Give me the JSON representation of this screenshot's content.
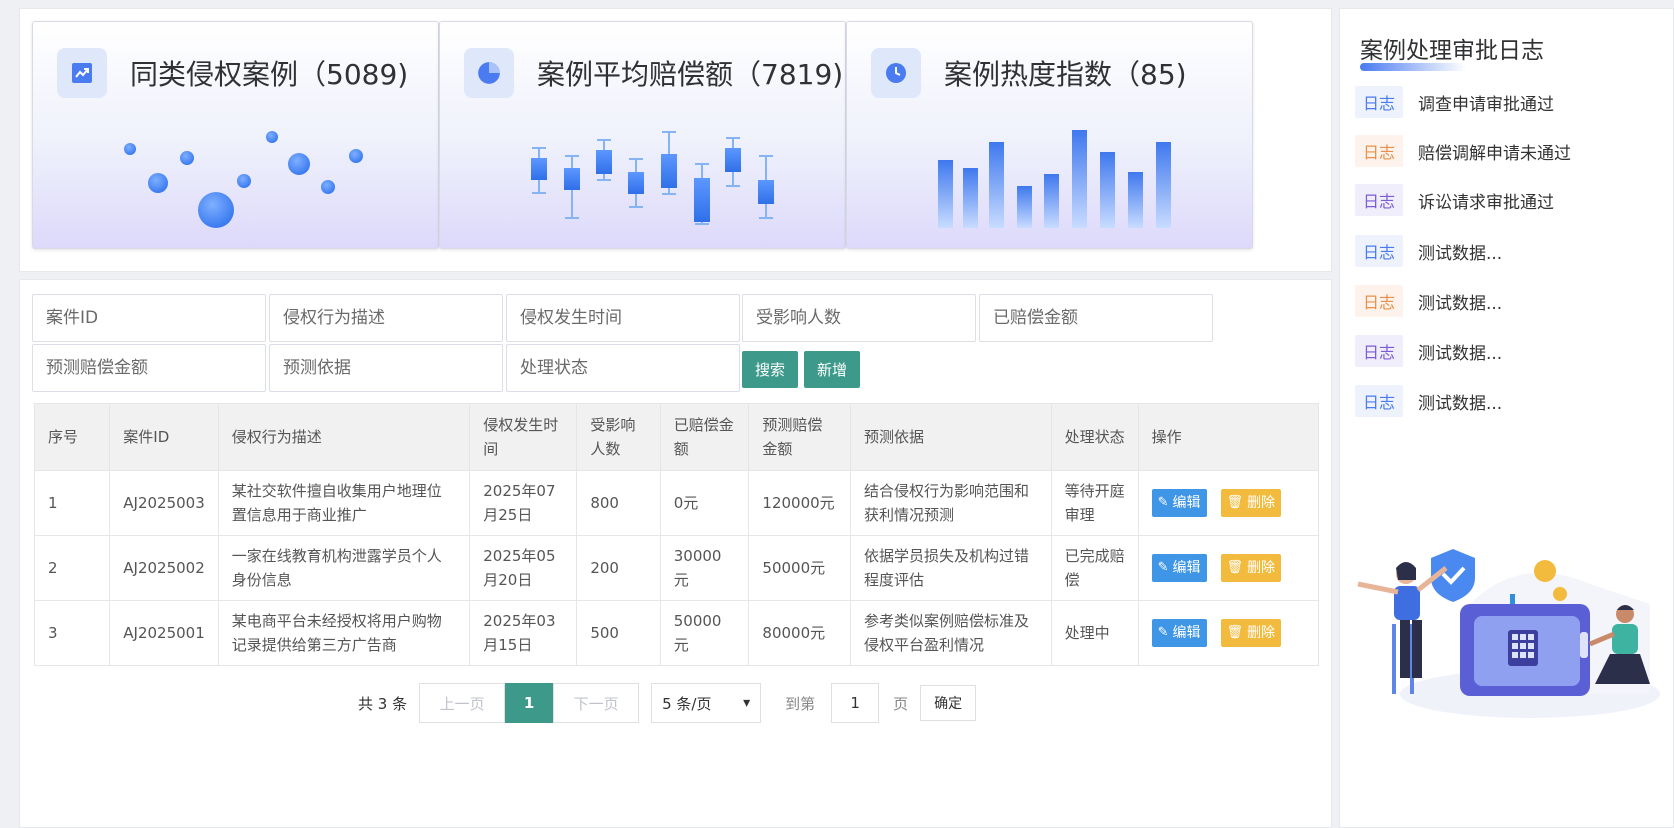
{
  "stats": [
    {
      "icon": "trend-chart-icon",
      "title": "同类侵权案例（5089)"
    },
    {
      "icon": "pie-chart-icon",
      "title": "案例平均赔偿额（7819)"
    },
    {
      "icon": "clock-icon",
      "title": "案例热度指数（85)"
    }
  ],
  "filters": {
    "case_id": "案件ID",
    "behavior": "侵权行为描述",
    "time": "侵权发生时间",
    "affected": "受影响人数",
    "paid": "已赔偿金额",
    "predicted": "预测赔偿金额",
    "basis": "预测依据",
    "status": "处理状态"
  },
  "buttons": {
    "search": "搜索",
    "add": "新增"
  },
  "table": {
    "headers": [
      "序号",
      "案件ID",
      "侵权行为描述",
      "侵权发生时间",
      "受影响人数",
      "已赔偿金额",
      "预测赔偿金额",
      "预测依据",
      "处理状态",
      "操作"
    ],
    "rows": [
      [
        "1",
        "AJ2025003",
        "某社交软件擅自收集用户地理位置信息用于商业推广",
        "2025年07月25日",
        "800",
        "0元",
        "120000元",
        "结合侵权行为影响范围和获利情况预测",
        "等待开庭审理"
      ],
      [
        "2",
        "AJ2025002",
        "一家在线教育机构泄露学员个人身份信息",
        "2025年05月20日",
        "200",
        "30000元",
        "50000元",
        "依据学员损失及机构过错程度评估",
        "已完成赔偿"
      ],
      [
        "3",
        "AJ2025001",
        "某电商平台未经授权将用户购物记录提供给第三方广告商",
        "2025年03月15日",
        "500",
        "50000元",
        "80000元",
        "参考类似案例赔偿标准及侵权平台盈利情况",
        "处理中"
      ]
    ],
    "edit_label": "编辑",
    "delete_label": "删除"
  },
  "pagination": {
    "total": "共 3 条",
    "prev": "上一页",
    "current": "1",
    "next": "下一页",
    "page_size": "5 条/页",
    "goto_label": "到第",
    "goto_value": "1",
    "page_unit": "页",
    "confirm": "确定"
  },
  "side": {
    "title": "案例处理审批日志",
    "tag": "日志",
    "logs": [
      "调查申请审批通过",
      "赔偿调解申请未通过",
      "诉讼请求审批通过",
      "测试数据...",
      "测试数据...",
      "测试数据...",
      "测试数据..."
    ]
  },
  "colors": {
    "accent_green": "#3d9a8a",
    "edit_blue": "#3f95e6",
    "delete_yellow": "#f3bb3d",
    "tag_blue": "#4a7bf0",
    "tag_orange": "#e8904a",
    "tag_purple": "#7c5bd6"
  }
}
